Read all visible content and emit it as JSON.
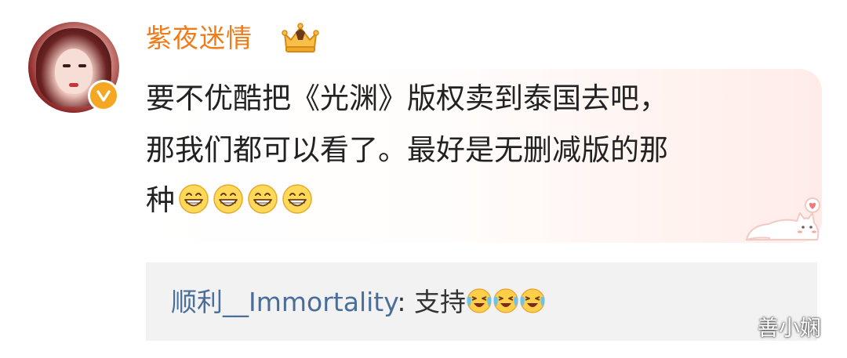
{
  "comment": {
    "user": {
      "name": "紫夜迷情",
      "avatar_icon": "avatar-photo",
      "verified_badge_icon": "verified-v-icon",
      "member_badge_icon": "crown-icon"
    },
    "text_lines": [
      "要不优酷把《光渊》版权卖到泰国去吧，",
      "那我们都可以看了。最好是无删减版的那",
      "种"
    ],
    "emojis": [
      "grinning-face",
      "grinning-face",
      "grinning-face",
      "grinning-face"
    ]
  },
  "reply": {
    "user": "顺利__Immortality",
    "separator": ": ",
    "text": "支持",
    "emojis": [
      "crying-laugh-face",
      "crying-laugh-face",
      "crying-laugh-face"
    ]
  },
  "watermark": "善小娴",
  "colors": {
    "username": "#f07b1a",
    "reply_username": "#4a6d9a",
    "reply_background": "#f2f2f2",
    "badge": "#f5a623"
  }
}
